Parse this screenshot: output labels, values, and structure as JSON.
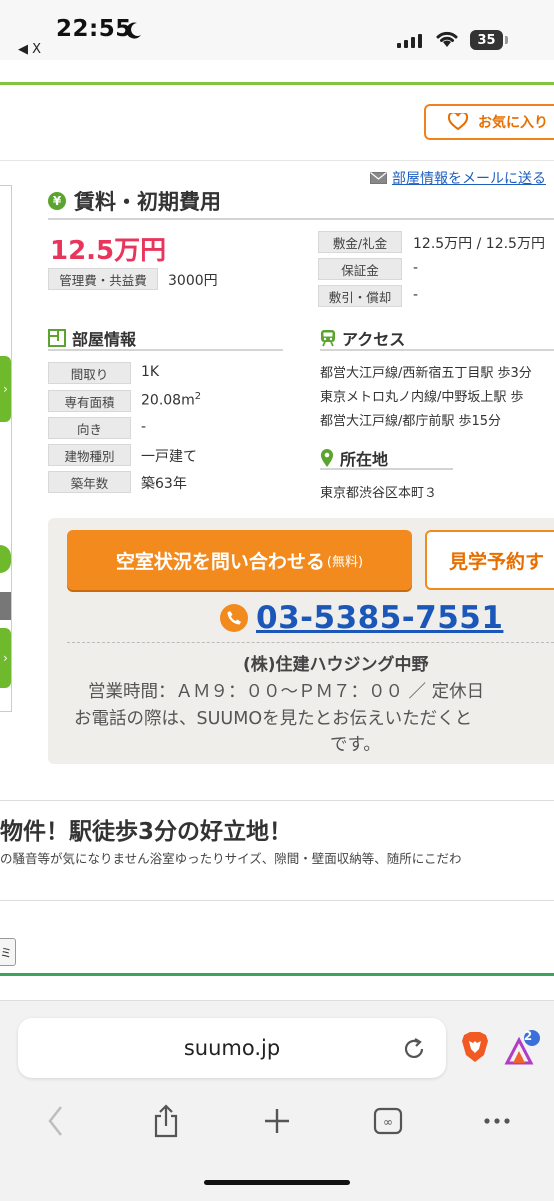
{
  "status_bar": {
    "time": "22:55",
    "back_label": "◀ X",
    "battery": "35"
  },
  "header": {
    "favorite_label": "お気に入り"
  },
  "mail_link": "部屋情報をメールに送る",
  "rent_section": {
    "heading": "賃料・初期費用",
    "price": "12.5万円",
    "management_fee_label": "管理費・共益費",
    "management_fee_value": "3000円",
    "rows": [
      {
        "label": "敷金/礼金",
        "value": "12.5万円 / 12.5万円"
      },
      {
        "label": "保証金",
        "value": "-"
      },
      {
        "label": "敷引・償却",
        "value": "-"
      }
    ]
  },
  "room_info": {
    "heading": "部屋情報",
    "rows": [
      {
        "label": "間取り",
        "value": "1K"
      },
      {
        "label": "専有面積",
        "value": "20.08m",
        "sup": "2"
      },
      {
        "label": "向き",
        "value": "-"
      },
      {
        "label": "建物種別",
        "value": "一戸建て"
      },
      {
        "label": "築年数",
        "value": "築63年"
      }
    ]
  },
  "access": {
    "heading": "アクセス",
    "lines": [
      "都営大江戸線/西新宿五丁目駅 歩3分",
      "東京メトロ丸ノ内線/中野坂上駅 歩",
      "都営大江戸線/都庁前駅 歩15分"
    ]
  },
  "location": {
    "heading": "所在地",
    "address": "東京都渋谷区本町３"
  },
  "contact": {
    "inquiry_label": "空室状況を問い合わせる",
    "inquiry_free": "(無料)",
    "visit_label": "見学予約す",
    "phone": "03-5385-7551",
    "company": "(株)住建ハウジング中野",
    "hours": "営業時間：ＡＭ９：００〜ＰＭ７：００ ／ 定休日",
    "note_line1": "お電話の際は、SUUMOを見たとお伝えいただくと",
    "note_line2": "です。"
  },
  "catch": {
    "heading": "物件！駅徒歩3分の好立地！",
    "body": "の騒音等が気になりません浴室ゆったりサイズ、隙間・壁面収納等、随所にこだわ"
  },
  "mini_button": "ミ",
  "browser": {
    "url": "suumo.jp",
    "badge": "2"
  },
  "colors": {
    "accent_orange": "#f28a1e",
    "price_red": "#e8355c",
    "brand_green": "#86c440",
    "link_blue": "#1a57b8"
  }
}
